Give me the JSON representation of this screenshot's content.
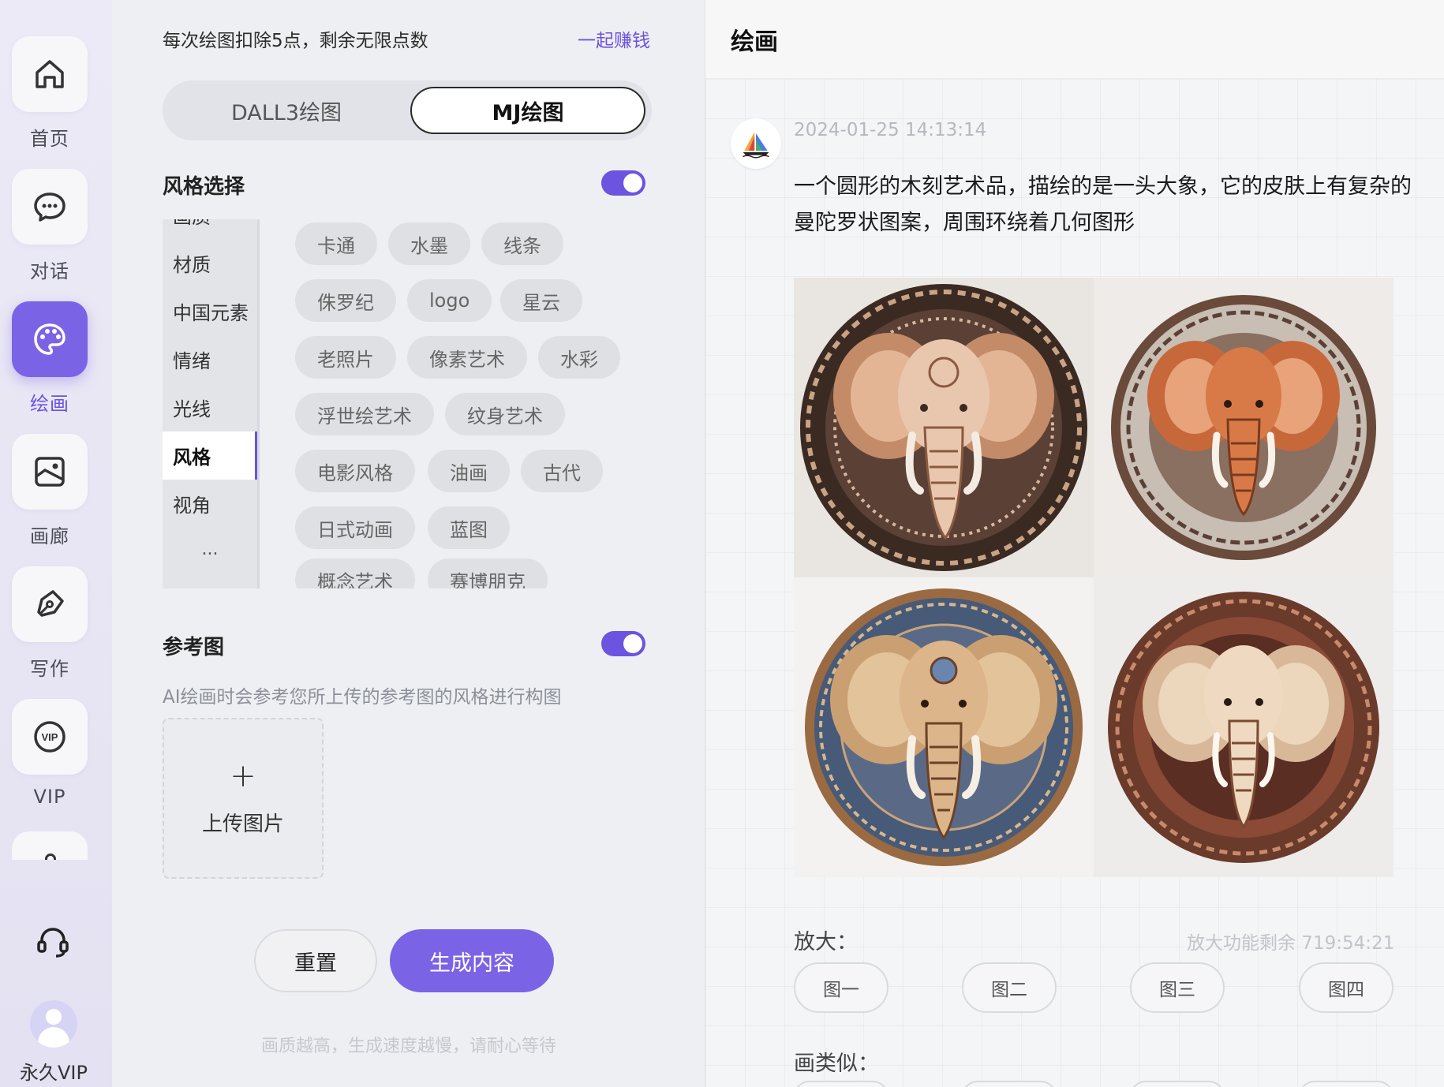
{
  "sidebar": {
    "items": [
      {
        "label": "首页",
        "icon": "home-icon"
      },
      {
        "label": "对话",
        "icon": "chat-icon"
      },
      {
        "label": "绘画",
        "icon": "palette-icon",
        "active": true
      },
      {
        "label": "画廊",
        "icon": "gallery-icon"
      },
      {
        "label": "写作",
        "icon": "pen-icon"
      },
      {
        "label": "VIP",
        "icon": "vip-icon"
      }
    ],
    "support_icon": "headset-icon",
    "user_label": "永久VIP",
    "accent": "#7b63e6"
  },
  "panel": {
    "points_info": "每次绘图扣除5点，剩余无限点数",
    "earn_link": "一起赚钱",
    "mode_tabs": [
      {
        "label": "DALL3绘图",
        "active": false
      },
      {
        "label": "MJ绘图",
        "active": true
      }
    ],
    "style_section": {
      "title": "风格选择",
      "enabled": true,
      "categories": [
        "画质",
        "材质",
        "中国元素",
        "情绪",
        "光线",
        "风格",
        "视角"
      ],
      "active_category": "风格",
      "more": "...",
      "tags": [
        "卡通",
        "水墨",
        "线条",
        "侏罗纪",
        "logo",
        "星云",
        "老照片",
        "像素艺术",
        "水彩",
        "浮世绘艺术",
        "纹身艺术",
        "电影风格",
        "油画",
        "古代",
        "日式动画",
        "蓝图",
        "概念艺术",
        "赛博朋克"
      ]
    },
    "reference_section": {
      "title": "参考图",
      "enabled": true,
      "description": "AI绘画时会参考您所上传的参考图的风格进行构图",
      "upload_plus": "+",
      "upload_label": "上传图片"
    },
    "reset_button": "重置",
    "generate_button": "生成内容",
    "hint": "画质越高，生成速度越慢，请耐心等待"
  },
  "main": {
    "title": "绘画",
    "message": {
      "avatar_icon": "sailboat-logo-icon",
      "time": "2024-01-25 14:13:14",
      "text": "一个圆形的木刻艺术品，描绘的是一头大象，它的皮肤上有复杂的曼陀罗状图案，周围环绕着几何图形"
    },
    "upscale_label": "放大：",
    "upscale_remaining": "放大功能剩余 719:54:21",
    "image_buttons": [
      "图一",
      "图二",
      "图三",
      "图四"
    ],
    "similar_label": "画类似："
  }
}
